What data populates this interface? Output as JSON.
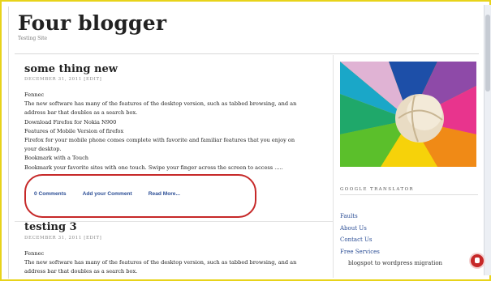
{
  "blog": {
    "title": "Four blogger",
    "tagline": "Testing Site"
  },
  "post1": {
    "title": "some thing new",
    "meta": "DECEMBER 31, 2011 [EDIT]",
    "lines": [
      "Fennec",
      "The new software has many of the features of the desktop version, such as tabbed browsing, and an",
      "address bar that doubles as a search box.",
      "Download Firefox for Nokia N900",
      "Features of Mobile Version of firefox",
      "Firefox for your mobile phone comes complete with favorite and familiar features that you enjoy on",
      "your desktop.",
      "Bookmark with a Touch",
      "Bookmark your favorite sites with one touch. Swipe your finger across the screen to access ....."
    ],
    "links": {
      "comments": "0 Comments",
      "add_comment": "Add your Comment",
      "read_more": "Read More..."
    }
  },
  "post2": {
    "title": "testing 3",
    "meta": "DECEMBER 31, 2011 [EDIT]",
    "lines": [
      "Fennec",
      "The new software has many of the features of the desktop version, such as tabbed browsing, and an",
      "address bar that doubles as a search box."
    ]
  },
  "sidebar": {
    "widget_title": "GOOGLE TRANSLATOR",
    "links": [
      "Faults",
      "About Us",
      "Contact Us",
      "Free Services"
    ],
    "sublink": "blogspot to wordpress migration"
  },
  "colors": {
    "accent": "#e8d31a",
    "link": "#2d4f96",
    "highlight": "#c62828"
  }
}
